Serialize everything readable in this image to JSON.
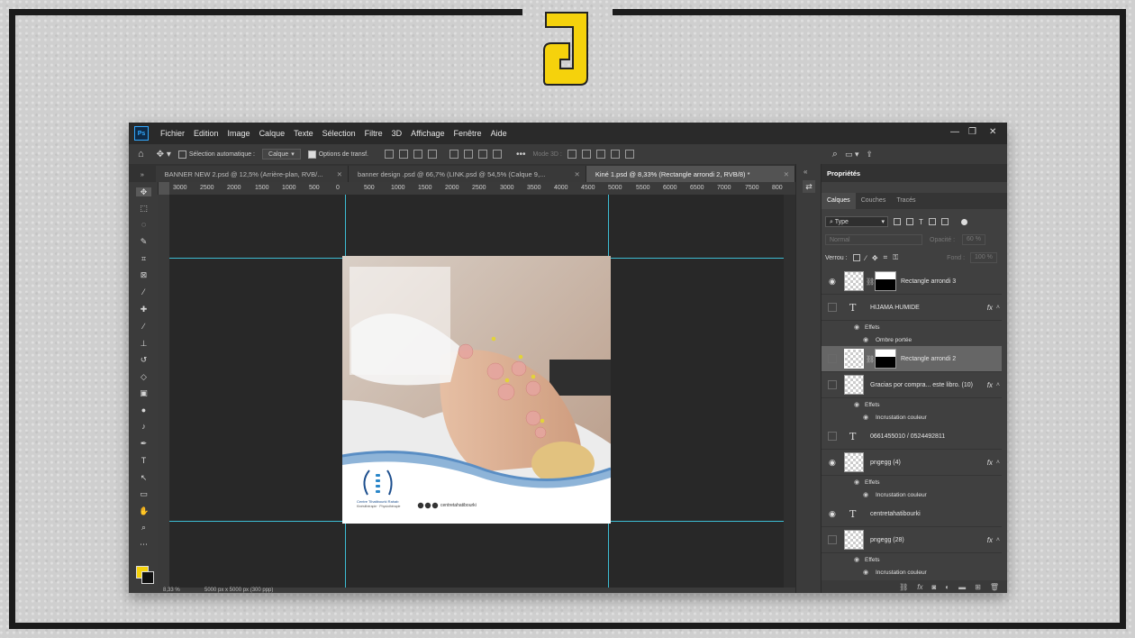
{
  "menubar": {
    "items": [
      "Fichier",
      "Edition",
      "Image",
      "Calque",
      "Texte",
      "Sélection",
      "Filtre",
      "3D",
      "Affichage",
      "Fenêtre",
      "Aide"
    ]
  },
  "options": {
    "auto_select_label": "Sélection automatique :",
    "target_value": "Calque",
    "transform_label": "Options de transf.",
    "mode3d_label": "Mode 3D :"
  },
  "tabs": [
    {
      "label": "BANNER NEW 2.psd @ 12,5% (Arrière-plan, RVB/..."
    },
    {
      "label": "banner design .psd @ 66,7% (LINK.psd @ 54,5% (Calque 9,..."
    },
    {
      "label": "Kiné 1.psd @ 8,33% (Rectangle arrondi 2, RVB/8) *"
    }
  ],
  "ruler": {
    "h_ticks": [
      "3000",
      "2500",
      "2000",
      "1500",
      "1000",
      "500",
      "0",
      "500",
      "1000",
      "1500",
      "2000",
      "2500",
      "3000",
      "3500",
      "4000",
      "4500",
      "5000",
      "5500",
      "6000",
      "6500",
      "7000",
      "7500",
      "800"
    ]
  },
  "status": {
    "zoom": "8,33 %",
    "doc_size": "5000 px x 5000 px (300 ppp)"
  },
  "panel": {
    "title": "Propriétés",
    "tabs": [
      "Calques",
      "Couches",
      "Tracés"
    ],
    "filter_type": "Type",
    "blend_mode": "Normal",
    "opacity_label": "Opacité :",
    "opacity_value": "60 %",
    "lock_label": "Verrou :",
    "fill_label": "Fond :",
    "fill_value": "100 %"
  },
  "layers": [
    {
      "name": "Rectangle arrondi 3"
    },
    {
      "name": "HIJAMA HUMIDE"
    },
    {
      "name": "Rectangle arrondi 2"
    },
    {
      "name": "Gracias por compra... este libro. (10)"
    },
    {
      "name": "0661455010  /  0524492811"
    },
    {
      "name": "pngegg (4)"
    },
    {
      "name": "centretahatibourki"
    },
    {
      "name": "pngegg (28)"
    }
  ],
  "effects": {
    "effects_label": "Effets",
    "drop_shadow": "Ombre portée",
    "color_overlay": "Incrustation couleur"
  },
  "document": {
    "clinic_name": "Centre Tihatibourki Rahab",
    "clinic_sub": "Kinésithérapie · Physiothérapie",
    "social_handle": "centretahatibourki"
  },
  "colors": {
    "foreground": "#f5d20c",
    "background": "#111111",
    "accent": "#3dbdd4"
  }
}
